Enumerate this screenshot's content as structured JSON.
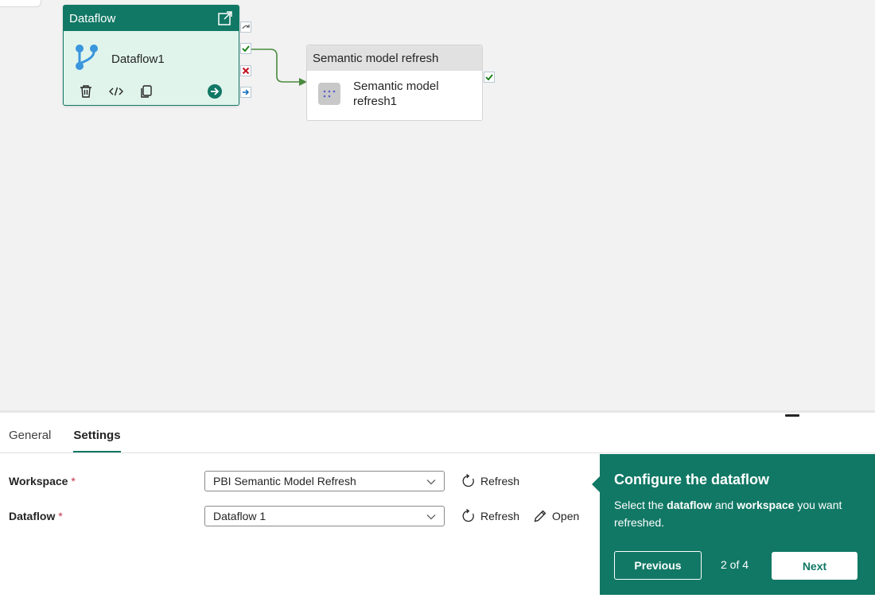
{
  "canvas": {
    "dataflow_activity": {
      "header": "Dataflow",
      "name": "Dataflow1",
      "header_color": "#117865",
      "body_color": "#e0f4ec"
    },
    "semantic_activity": {
      "header": "Semantic model refresh",
      "name": "Semantic model refresh1"
    },
    "ports": [
      "skip",
      "success",
      "failure",
      "completion"
    ]
  },
  "panel": {
    "tabs": [
      {
        "label": "General",
        "active": false
      },
      {
        "label": "Settings",
        "active": true
      }
    ],
    "workspace": {
      "label": "Workspace",
      "required_mark": "*",
      "value": "PBI Semantic Model Refresh",
      "refresh_label": "Refresh"
    },
    "dataflow": {
      "label": "Dataflow",
      "required_mark": "*",
      "value": "Dataflow 1",
      "refresh_label": "Refresh",
      "open_label": "Open"
    }
  },
  "callout": {
    "title": "Configure the dataflow",
    "body_parts": [
      "Select the ",
      "dataflow",
      " and ",
      "workspace",
      " you want refreshed."
    ],
    "previous_label": "Previous",
    "step": "2 of 4",
    "next_label": "Next",
    "color": "#117865"
  }
}
